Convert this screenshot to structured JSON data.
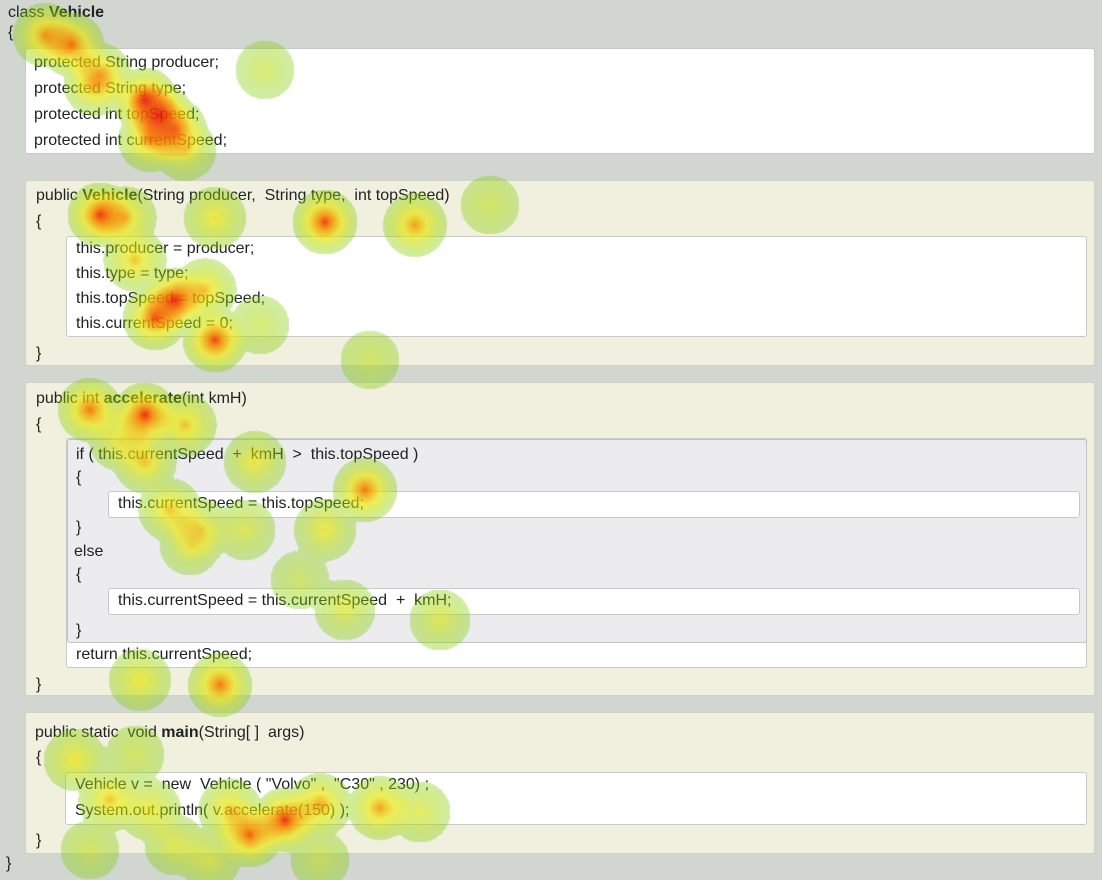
{
  "class_header": {
    "keyword": "class",
    "name": "Vehicle",
    "open_brace": "{",
    "close_brace": "}"
  },
  "fields": [
    "protected String producer;",
    "protected String type;",
    "protected int topSpeed;",
    "protected int currentSpeed;"
  ],
  "constructor": {
    "modifier": "public",
    "name": "Vehicle",
    "params": "(String producer,  String type,  int topSpeed)",
    "open_brace": "{",
    "close_brace": "}",
    "body": [
      "this.producer = producer;",
      "this.type = type;",
      "this.topSpeed = topSpeed;",
      "this.currentSpeed = 0;"
    ]
  },
  "accelerate": {
    "modifier": "public int",
    "name": "accelerate",
    "params": "(int kmH)",
    "open_brace": "{",
    "close_brace": "}",
    "if_condition": "if ( this.currentSpeed  +  kmH  >  this.topSpeed )",
    "if_open": "{",
    "if_body": "this.currentSpeed = this.topSpeed;",
    "if_close": "}",
    "else_keyword": "else",
    "else_open": "{",
    "else_body": "this.currentSpeed = this.currentSpeed  +  kmH;",
    "else_close": "}",
    "return_stmt": "return this.currentSpeed;"
  },
  "main": {
    "modifier": "public static  void",
    "name": "main",
    "params": "(String[ ]  args)",
    "open_brace": "{",
    "close_brace": "}",
    "body": [
      "Vehicle v =  new  Vehicle ( \"Volvo\" ,  \"C30\" , 230) ;",
      "System.out.println( v.accelerate(150) );"
    ]
  },
  "colors": {
    "page_background": "#d1d6d1",
    "field_block": "#ffffff",
    "method_block": "#f1f0df",
    "if_else_block": "#ececee",
    "heat_low": "#7ac800",
    "heat_mid": "#e6e600",
    "heat_high": "#e60000"
  },
  "overlay": {
    "type": "eye-tracking-heatmap",
    "hotspots": [
      [
        45,
        35,
        0.7
      ],
      [
        72,
        45,
        0.8
      ],
      [
        100,
        75,
        0.6
      ],
      [
        145,
        100,
        0.95
      ],
      [
        160,
        115,
        0.9
      ],
      [
        175,
        130,
        0.7
      ],
      [
        150,
        140,
        0.7
      ],
      [
        95,
        85,
        0.5
      ],
      [
        185,
        150,
        0.5
      ],
      [
        265,
        70,
        0.3
      ],
      [
        100,
        215,
        0.9
      ],
      [
        125,
        218,
        0.6
      ],
      [
        215,
        218,
        0.5
      ],
      [
        325,
        222,
        0.9
      ],
      [
        415,
        225,
        0.7
      ],
      [
        490,
        205,
        0.3
      ],
      [
        135,
        260,
        0.6
      ],
      [
        175,
        300,
        0.95
      ],
      [
        155,
        318,
        0.85
      ],
      [
        215,
        340,
        0.9
      ],
      [
        205,
        290,
        0.6
      ],
      [
        260,
        325,
        0.3
      ],
      [
        370,
        360,
        0.3
      ],
      [
        90,
        410,
        0.8
      ],
      [
        145,
        415,
        0.95
      ],
      [
        185,
        425,
        0.6
      ],
      [
        120,
        440,
        0.5
      ],
      [
        145,
        462,
        0.6
      ],
      [
        255,
        462,
        0.5
      ],
      [
        365,
        490,
        0.8
      ],
      [
        170,
        510,
        0.6
      ],
      [
        200,
        530,
        0.5
      ],
      [
        245,
        530,
        0.4
      ],
      [
        325,
        530,
        0.5
      ],
      [
        190,
        545,
        0.4
      ],
      [
        345,
        610,
        0.4
      ],
      [
        440,
        620,
        0.4
      ],
      [
        300,
        580,
        0.3
      ],
      [
        220,
        685,
        0.8
      ],
      [
        140,
        680,
        0.5
      ],
      [
        75,
        760,
        0.5
      ],
      [
        135,
        755,
        0.3
      ],
      [
        110,
        800,
        0.6
      ],
      [
        150,
        810,
        0.5
      ],
      [
        230,
        810,
        0.6
      ],
      [
        285,
        820,
        0.95
      ],
      [
        250,
        835,
        0.85
      ],
      [
        320,
        805,
        0.7
      ],
      [
        380,
        808,
        0.7
      ],
      [
        420,
        812,
        0.4
      ],
      [
        175,
        845,
        0.4
      ],
      [
        90,
        850,
        0.3
      ],
      [
        210,
        860,
        0.4
      ],
      [
        320,
        860,
        0.3
      ]
    ]
  }
}
